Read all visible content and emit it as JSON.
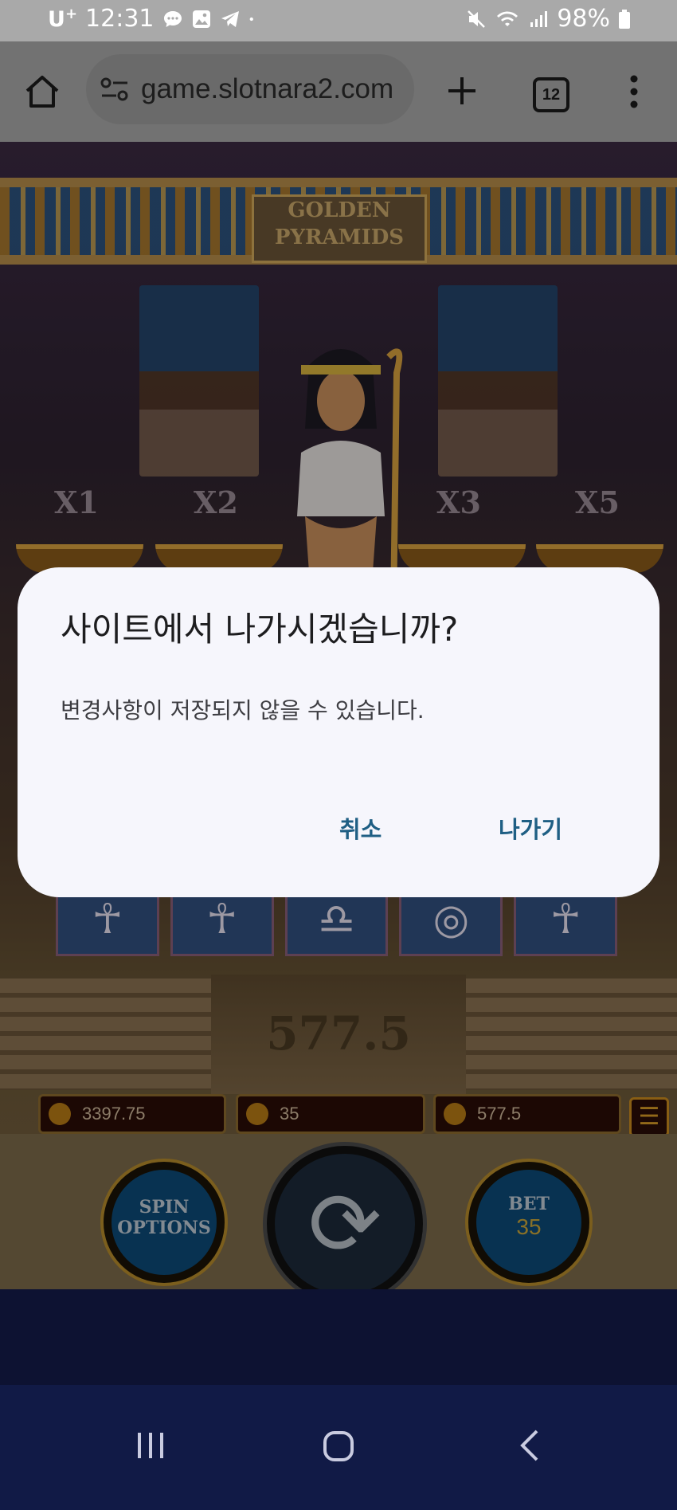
{
  "status_bar": {
    "carrier": "U",
    "carrier_sup": "+",
    "time": "12:31",
    "battery": "98%",
    "icons": [
      "chat-icon",
      "gallery-icon",
      "telegram-icon",
      "dot-icon",
      "mute-icon",
      "wifi-icon",
      "signal-icon",
      "battery-icon"
    ]
  },
  "browser": {
    "url": "game.slotnara2.com",
    "tab_count": "12",
    "icons": [
      "home-icon",
      "site-settings-icon",
      "new-tab-icon",
      "tab-switcher-icon",
      "more-vert-icon"
    ]
  },
  "game": {
    "title_line1": "GOLDEN",
    "title_line2": "PYRAMIDS",
    "multipliers": [
      "X1",
      "X2",
      "X3",
      "X5"
    ],
    "reel_symbols": [
      "☥",
      "☥",
      "♎",
      "◎",
      "☥"
    ],
    "win_display": "577.5",
    "hud": {
      "balance": "3397.75",
      "bet_amount": "35",
      "win_amount": "577.5"
    },
    "spin_options_line1": "SPIN",
    "spin_options_line2": "OPTIONS",
    "bet_label": "BET",
    "bet_value": "35"
  },
  "dialog": {
    "title": "사이트에서 나가시겠습니까?",
    "message": "변경사항이 저장되지 않을 수 있습니다.",
    "cancel_label": "취소",
    "leave_label": "나가기",
    "accent_color": "#1f5f84"
  },
  "nav": {
    "icons": [
      "recent-apps-icon",
      "home-nav-icon",
      "back-nav-icon"
    ]
  }
}
